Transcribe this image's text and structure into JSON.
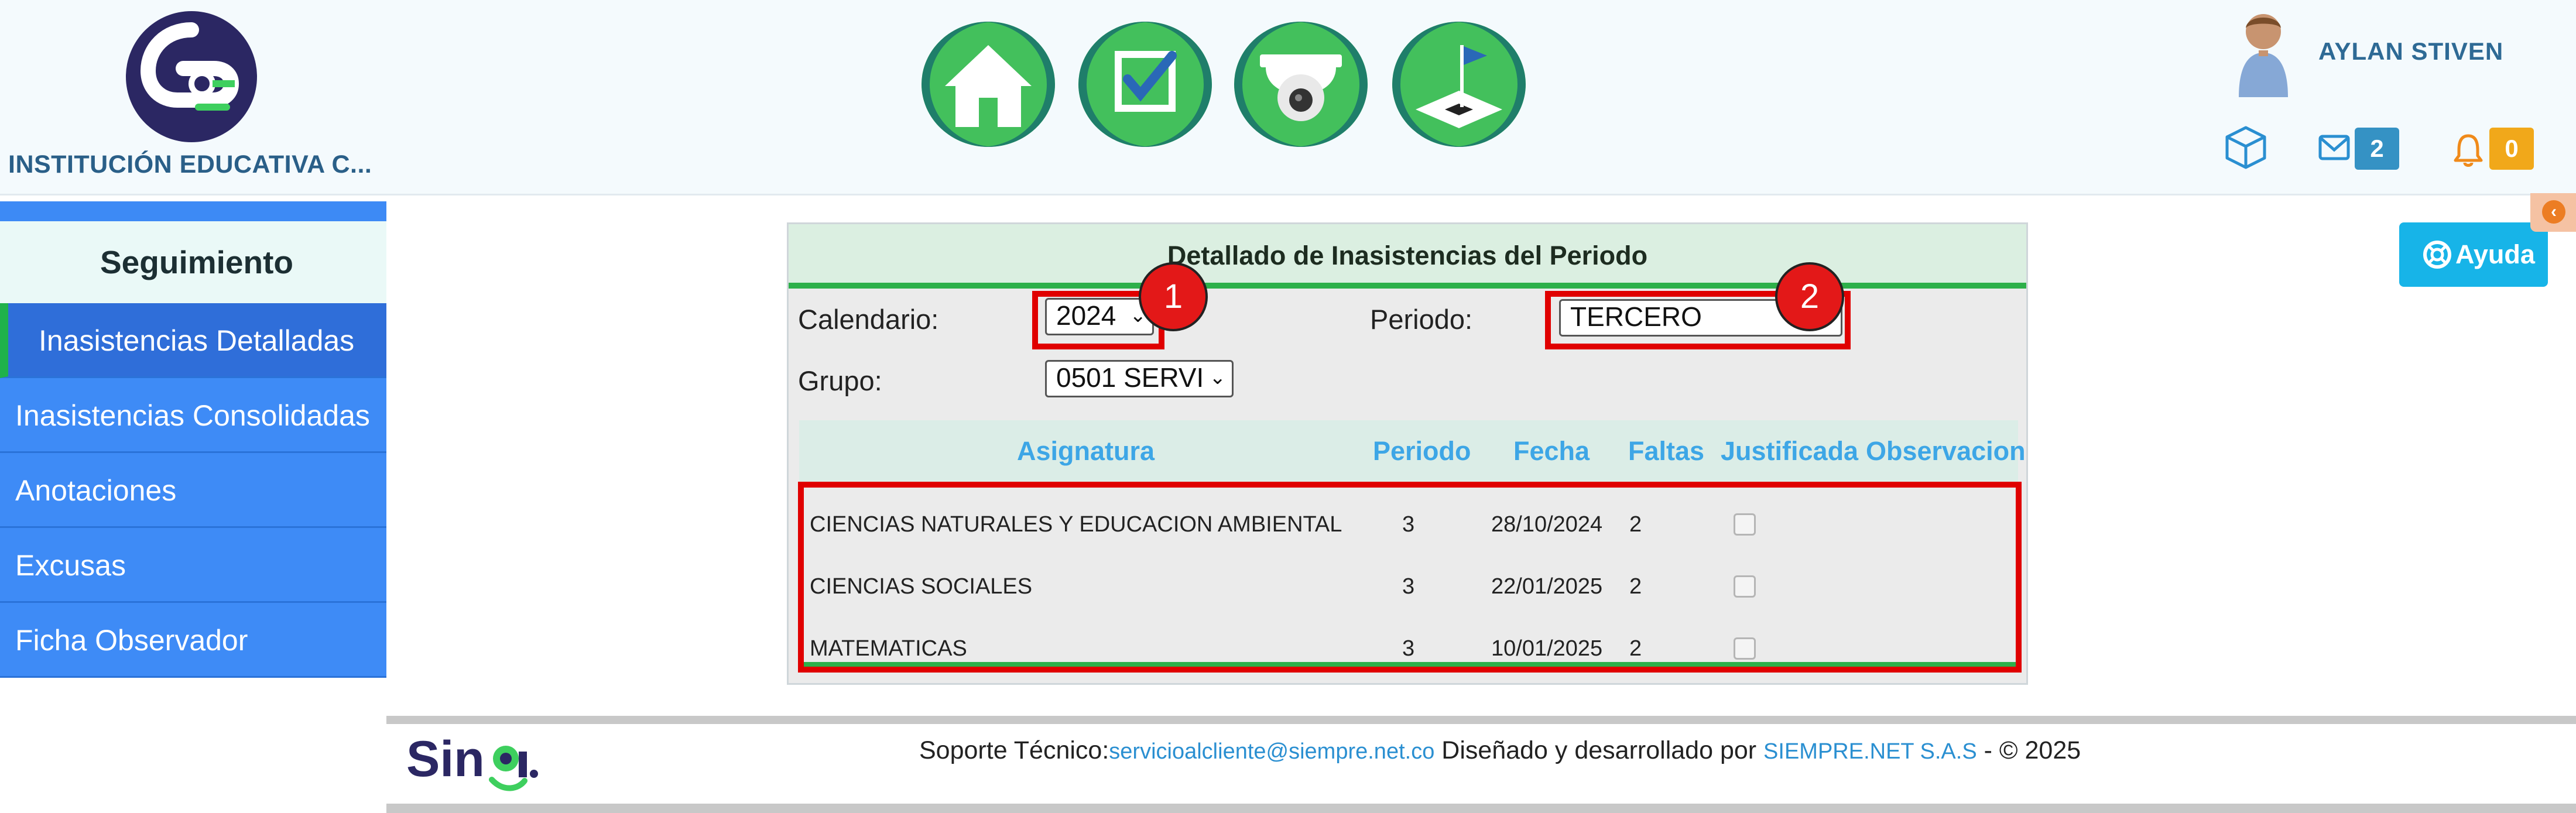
{
  "header": {
    "school_name": "INSTITUCIÓN EDUCATIVA C...",
    "nav_icons": [
      "home-icon",
      "checkbox-icon",
      "camera-icon",
      "flag-icon"
    ],
    "user_name": "AYLAN STIVEN",
    "mail_count": "2",
    "notification_count": "0"
  },
  "sidebar": {
    "header": "Seguimiento",
    "items": [
      {
        "label": "Inasistencias Detalladas",
        "active": true
      },
      {
        "label": "Inasistencias Consolidadas",
        "active": false
      },
      {
        "label": "Anotaciones",
        "active": false
      },
      {
        "label": "Excusas",
        "active": false
      },
      {
        "label": "Ficha Observador",
        "active": false
      }
    ]
  },
  "panel": {
    "title": "Detallado de Inasistencias del Periodo",
    "calendario_label": "Calendario:",
    "calendario_value": "2024",
    "periodo_label": "Periodo:",
    "periodo_value": "TERCERO",
    "grupo_label": "Grupo:",
    "grupo_value": "0501 SERVI",
    "marker_1": "1",
    "marker_2": "2",
    "columns": [
      "Asignatura",
      "Periodo",
      "Fecha",
      "Faltas",
      "Justificada",
      "Observacion"
    ],
    "rows": [
      {
        "asignatura": "CIENCIAS NATURALES Y EDUCACION AMBIENTAL",
        "periodo": "3",
        "fecha": "28/10/2024",
        "faltas": "2",
        "justificada": false
      },
      {
        "asignatura": "CIENCIAS SOCIALES",
        "periodo": "3",
        "fecha": "22/01/2025",
        "faltas": "2",
        "justificada": false
      },
      {
        "asignatura": "MATEMATICAS",
        "periodo": "3",
        "fecha": "10/01/2025",
        "faltas": "2",
        "justificada": false
      }
    ]
  },
  "help": {
    "label": "Ayuda"
  },
  "footer": {
    "soporte_label": "Soporte Técnico:",
    "email": "servicioalcliente@siempre.net.co",
    "disenado": " Diseñado y desarrollado por ",
    "company": "SIEMPRE.NET S.A.S",
    "copyright": " -  © 2025",
    "logo_text": "Sinai."
  },
  "colors": {
    "sidebar": "#3e8bf6",
    "accent_green": "#2db04a",
    "highlight_red": "#e00000",
    "help_button": "#17b4e8"
  }
}
